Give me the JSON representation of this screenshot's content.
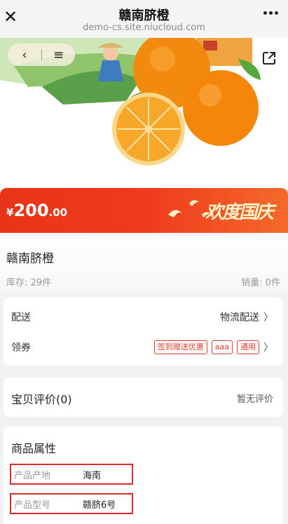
{
  "browser": {
    "title": "赣南脐橙",
    "url": "demo-cs.site.niucloud.com",
    "close_icon": "close-icon",
    "more_icon": "more-icon"
  },
  "hero": {
    "back_icon": "chevron-left-icon",
    "menu_icon": "menu-icon",
    "share_icon": "share-icon"
  },
  "price": {
    "currency": "¥",
    "integer": "200",
    "decimal": ".00",
    "festival_text": "欢度国庆",
    "color_start": "#e83418",
    "color_end": "#f46a2a"
  },
  "product": {
    "name": "赣南脐橙",
    "stock": "库存: 29件",
    "sales": "销量: 0件"
  },
  "delivery": {
    "label": "配送",
    "value": "物流配送"
  },
  "coupon": {
    "label": "领券",
    "tags": [
      "签到赠送优惠",
      "aaa",
      "通用"
    ]
  },
  "reviews": {
    "label": "宝贝评价(0)",
    "value": "暂无评价"
  },
  "attributes": {
    "title": "商品属性",
    "items": [
      {
        "key": "产品产地",
        "value": "海南"
      },
      {
        "key": "产品型号",
        "value": "赣脐6号"
      }
    ],
    "highlight_color": "#e02a2a"
  }
}
